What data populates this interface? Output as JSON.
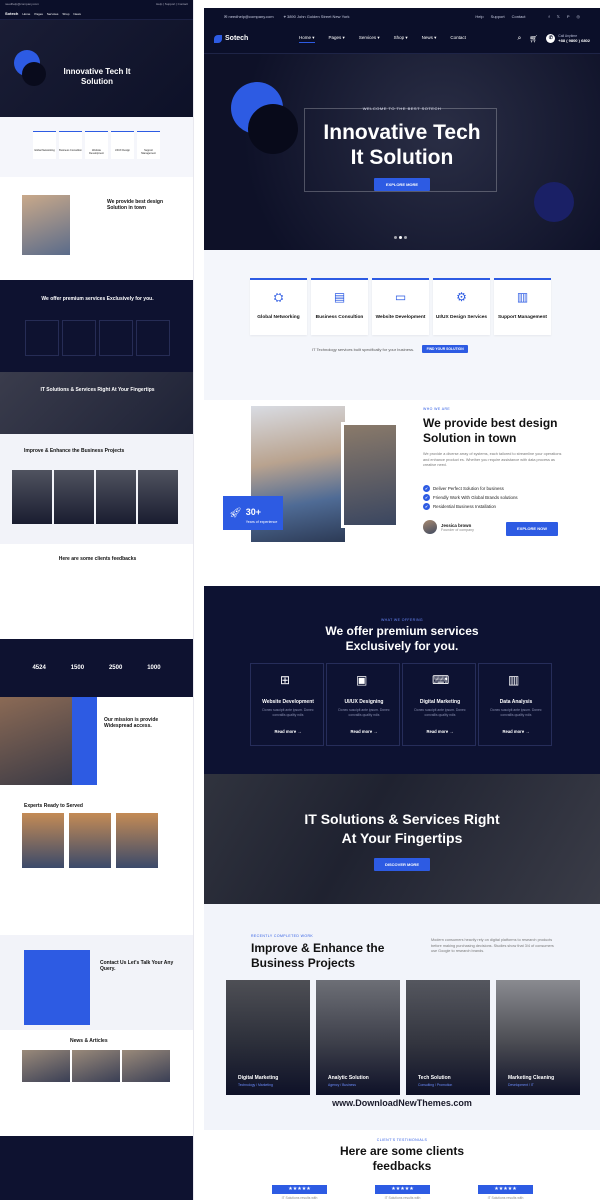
{
  "topbar": {
    "email": "needhelp@company.com",
    "address": "3890 John Golden Street New York",
    "links": [
      "Help",
      "Support",
      "Contact"
    ],
    "social_icons": [
      "facebook-icon",
      "twitter-icon",
      "pinterest-icon",
      "instagram-icon"
    ]
  },
  "nav": {
    "brand": "Sotech",
    "menu": [
      "Home",
      "Pages",
      "Services",
      "Shop",
      "News",
      "Contact"
    ],
    "call_label": "Call Anytime",
    "call_number": "+88 ( 9800 ) 6802"
  },
  "hero": {
    "welcome": "WELCOME TO THE BEST SOTECH",
    "title_line1": "Innovative Tech",
    "title_line2": "It Solution",
    "cta": "EXPLORE MORE"
  },
  "features": {
    "items": [
      "Global Networking",
      "Business Consultion",
      "Website Development",
      "UI/UX Design Services",
      "Support Management"
    ],
    "note": "IT Technology services built specifically for your business.",
    "note_button": "FIND YOUR SOLUTION"
  },
  "about": {
    "tag": "WHO WE ARE",
    "title": "We provide best design Solution in town",
    "text": "We provide a diverse array of systems, each tailored to streamline your operations and enhance product es. Whether you require assistance with data process as creative need.",
    "bullets": [
      "Deliver Perfect Solution for business",
      "Friendly Work With Global Brands solutions",
      "Residential Business Installation"
    ],
    "badge_number": "30+",
    "badge_text": "Years of experience",
    "author_name": "Jessica brown",
    "author_role": "Founder of company",
    "button": "EXPLORE NOW"
  },
  "offer": {
    "tag": "WHAT WE OFFERING",
    "title_line1": "We offer premium services",
    "title_line2": "Exclusively for you.",
    "cards": [
      {
        "title": "Website Development",
        "desc": "Donec suscipit ante ipsum. Donec convallis quality ndis",
        "more": "Read more →"
      },
      {
        "title": "UI/UX Designing",
        "desc": "Donec suscipit ante ipsum. Donec convallis quality ndis",
        "more": "Read more →"
      },
      {
        "title": "Digital Marketing",
        "desc": "Donec suscipit ante ipsum. Donec convallis quality ndis",
        "more": "Read more →"
      },
      {
        "title": "Data Analysis",
        "desc": "Donec suscipit ante ipsum. Donec convallis quality ndis",
        "more": "Read more →"
      }
    ]
  },
  "cta2": {
    "title_line1": "IT Solutions & Services Right",
    "title_line2": "At Your Fingertips",
    "button": "DISCOVER MORE"
  },
  "projects": {
    "tag": "RECENTLY COMPLETED WORK",
    "title_line1": "Improve & Enhance the",
    "title_line2": "Business Projects",
    "text": "Modern consumers heavily rely on digital platforms to research products before making purchasing decisions. Studies show that 3/4 of consumers use Google to research brands.",
    "items": [
      {
        "title": "Digital Marketing",
        "sub": "Technology / Marketing"
      },
      {
        "title": "Analytic Solution",
        "sub": "Agency / Business"
      },
      {
        "title": "Tech Solution",
        "sub": "Consulting / Promotion"
      },
      {
        "title": "Marketing Cleaning",
        "sub": "Development / IT"
      }
    ]
  },
  "watermark": "www.DownloadNewThemes.com",
  "testimonials": {
    "tag": "CLIENT'S TESTIMONIALS",
    "title_line1": "Here are some clients",
    "title_line2": "feedbacks",
    "stars": "★★★★★",
    "snippets": [
      "IT Solutions results with",
      "IT Solutions results with",
      "IT Solutions results with"
    ]
  },
  "left_preview": {
    "hero_title": "Innovative Tech It Solution",
    "about_title": "We provide best design Solution in town",
    "services_title": "We offer premium services Exclusively for you.",
    "cta_title": "IT Solutions & Services Right At Your Fingertips",
    "projects_title": "Improve & Enhance the Business Projects",
    "testimonials_title": "Here are some clients feedbacks",
    "counters": [
      "4524",
      "1500",
      "2500",
      "1000"
    ],
    "mission_title": "Our mission is provide Widespread access.",
    "team_title": "Experts Ready to Served",
    "contact_title": "Contact Us Let's Talk Your Any Query.",
    "news_title": "News & Articles",
    "feature_items": [
      "Global Networking",
      "Business Consultion",
      "Website Development",
      "UI/UX Design",
      "Support Management"
    ]
  },
  "colors": {
    "accent": "#2d5be3",
    "dark": "#0e1230"
  }
}
